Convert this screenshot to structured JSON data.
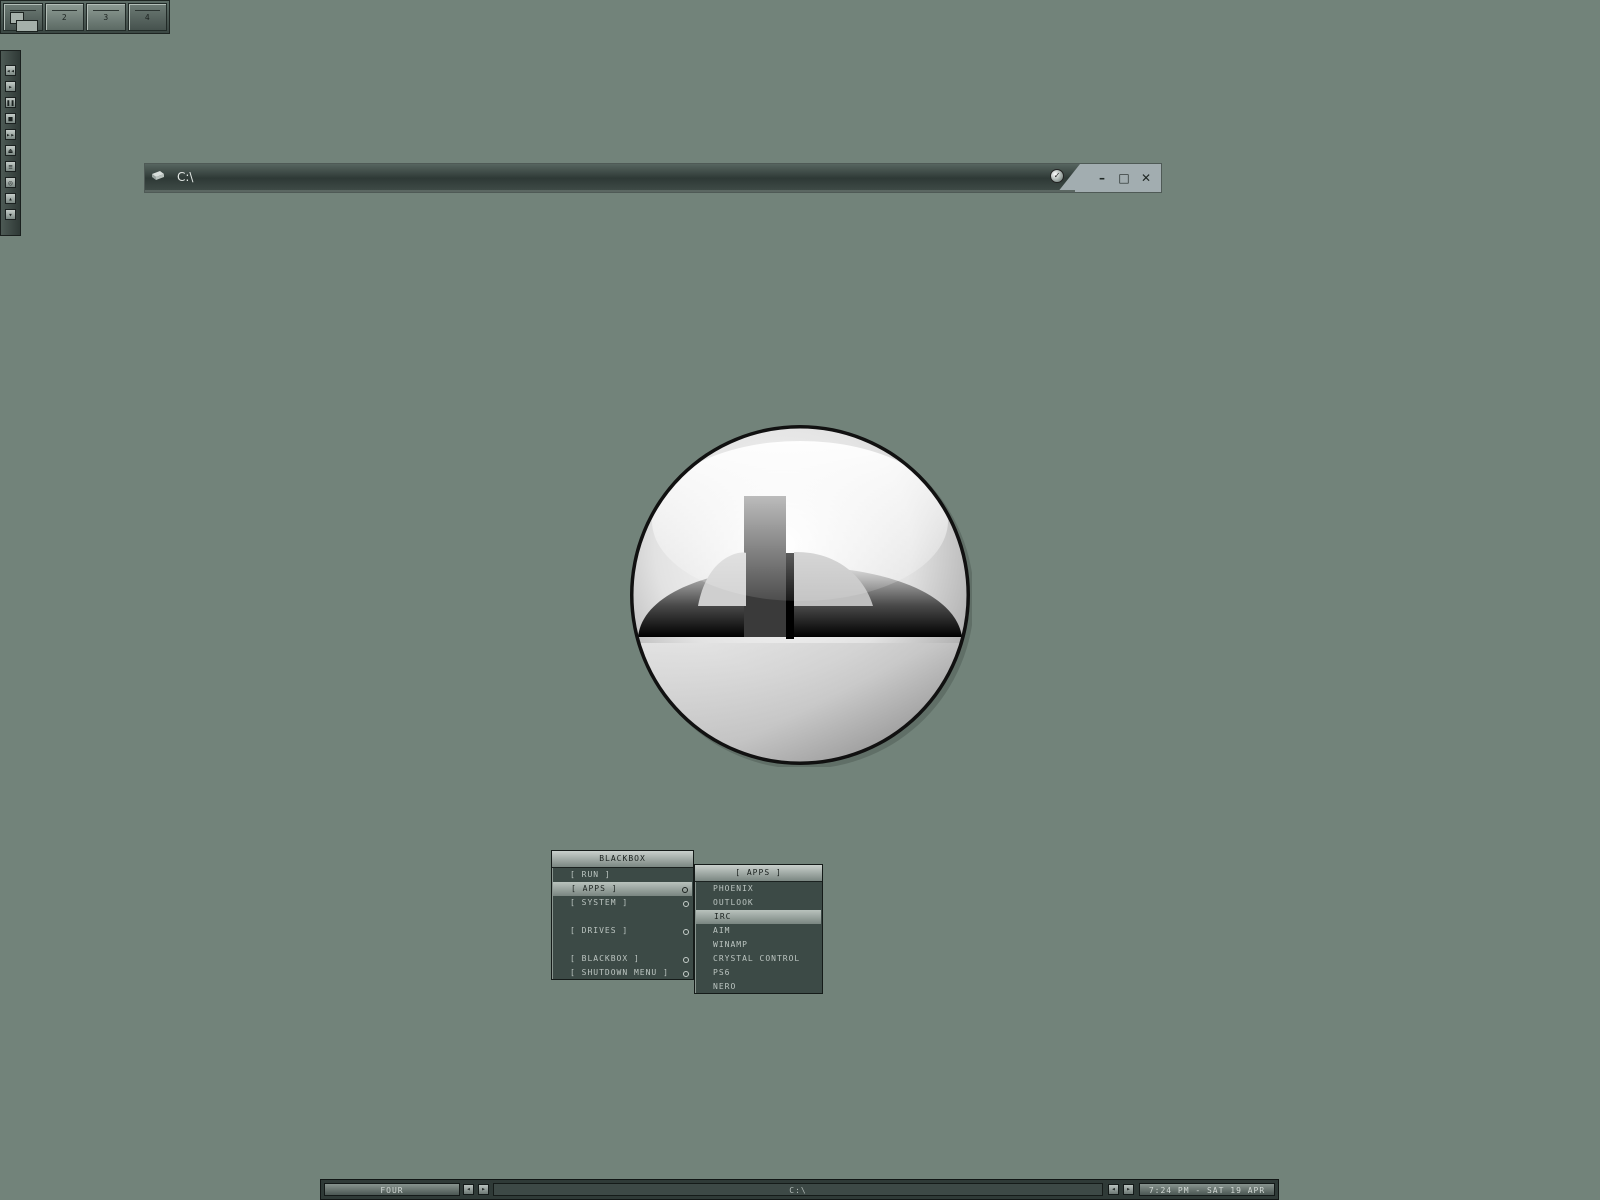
{
  "pager": {
    "workspaces": [
      {
        "label": "",
        "active": true
      },
      {
        "label": "2",
        "active": false
      },
      {
        "label": "3",
        "active": false
      },
      {
        "label": "4",
        "active": true
      }
    ]
  },
  "media_toolbar": {
    "buttons": [
      {
        "icon": "rewind-icon",
        "glyph": "◂◂"
      },
      {
        "icon": "play-icon",
        "glyph": "▸"
      },
      {
        "icon": "pause-icon",
        "glyph": "❚❚"
      },
      {
        "icon": "stop-icon",
        "glyph": "■"
      },
      {
        "icon": "fast-forward-icon",
        "glyph": "▸▸"
      },
      {
        "icon": "eject-icon",
        "glyph": "⏏"
      },
      {
        "icon": "playlist-icon",
        "glyph": "≡"
      },
      {
        "icon": "settings-icon",
        "glyph": "◎"
      },
      {
        "icon": "volume-up-icon",
        "glyph": "▴"
      },
      {
        "icon": "volume-down-icon",
        "glyph": "▾"
      }
    ]
  },
  "window": {
    "title": "C:\\",
    "icon": "drive-icon",
    "pin_icon": "pin-icon",
    "minimize_glyph": "–",
    "maximize_glyph": "□",
    "close_glyph": "✕"
  },
  "logo": {
    "icon": "deviantart-logo-icon"
  },
  "menu": {
    "title": "BLACKBOX",
    "items": [
      {
        "label": "[ RUN ]",
        "submenu": false,
        "selected": false
      },
      {
        "label": "[ APPS ]",
        "submenu": true,
        "selected": true
      },
      {
        "label": "[ SYSTEM ]",
        "submenu": true,
        "selected": false
      },
      {
        "label": "",
        "separator": true
      },
      {
        "label": "[ DRIVES ]",
        "submenu": true,
        "selected": false
      },
      {
        "label": "",
        "separator": true
      },
      {
        "label": "[ BLACKBOX ]",
        "submenu": true,
        "selected": false
      },
      {
        "label": "[ SHUTDOWN MENU ]",
        "submenu": true,
        "selected": false
      }
    ]
  },
  "submenu": {
    "title": "[ APPS ]",
    "items": [
      {
        "label": "PHOENIX",
        "selected": false
      },
      {
        "label": "OUTLOOK",
        "selected": false
      },
      {
        "label": "IRC",
        "selected": true
      },
      {
        "label": "AIM",
        "selected": false
      },
      {
        "label": "WINAMP",
        "selected": false
      },
      {
        "label": "CRYSTAL CONTROL",
        "selected": false
      },
      {
        "label": "PS6",
        "selected": false
      },
      {
        "label": "NERO",
        "selected": false
      }
    ]
  },
  "taskbar": {
    "workspace_name": "FOUR",
    "task_title": "C:\\",
    "clock": "7:24 PM - SAT 19 APR",
    "prev_glyph": "◂",
    "next_glyph": "▸"
  }
}
